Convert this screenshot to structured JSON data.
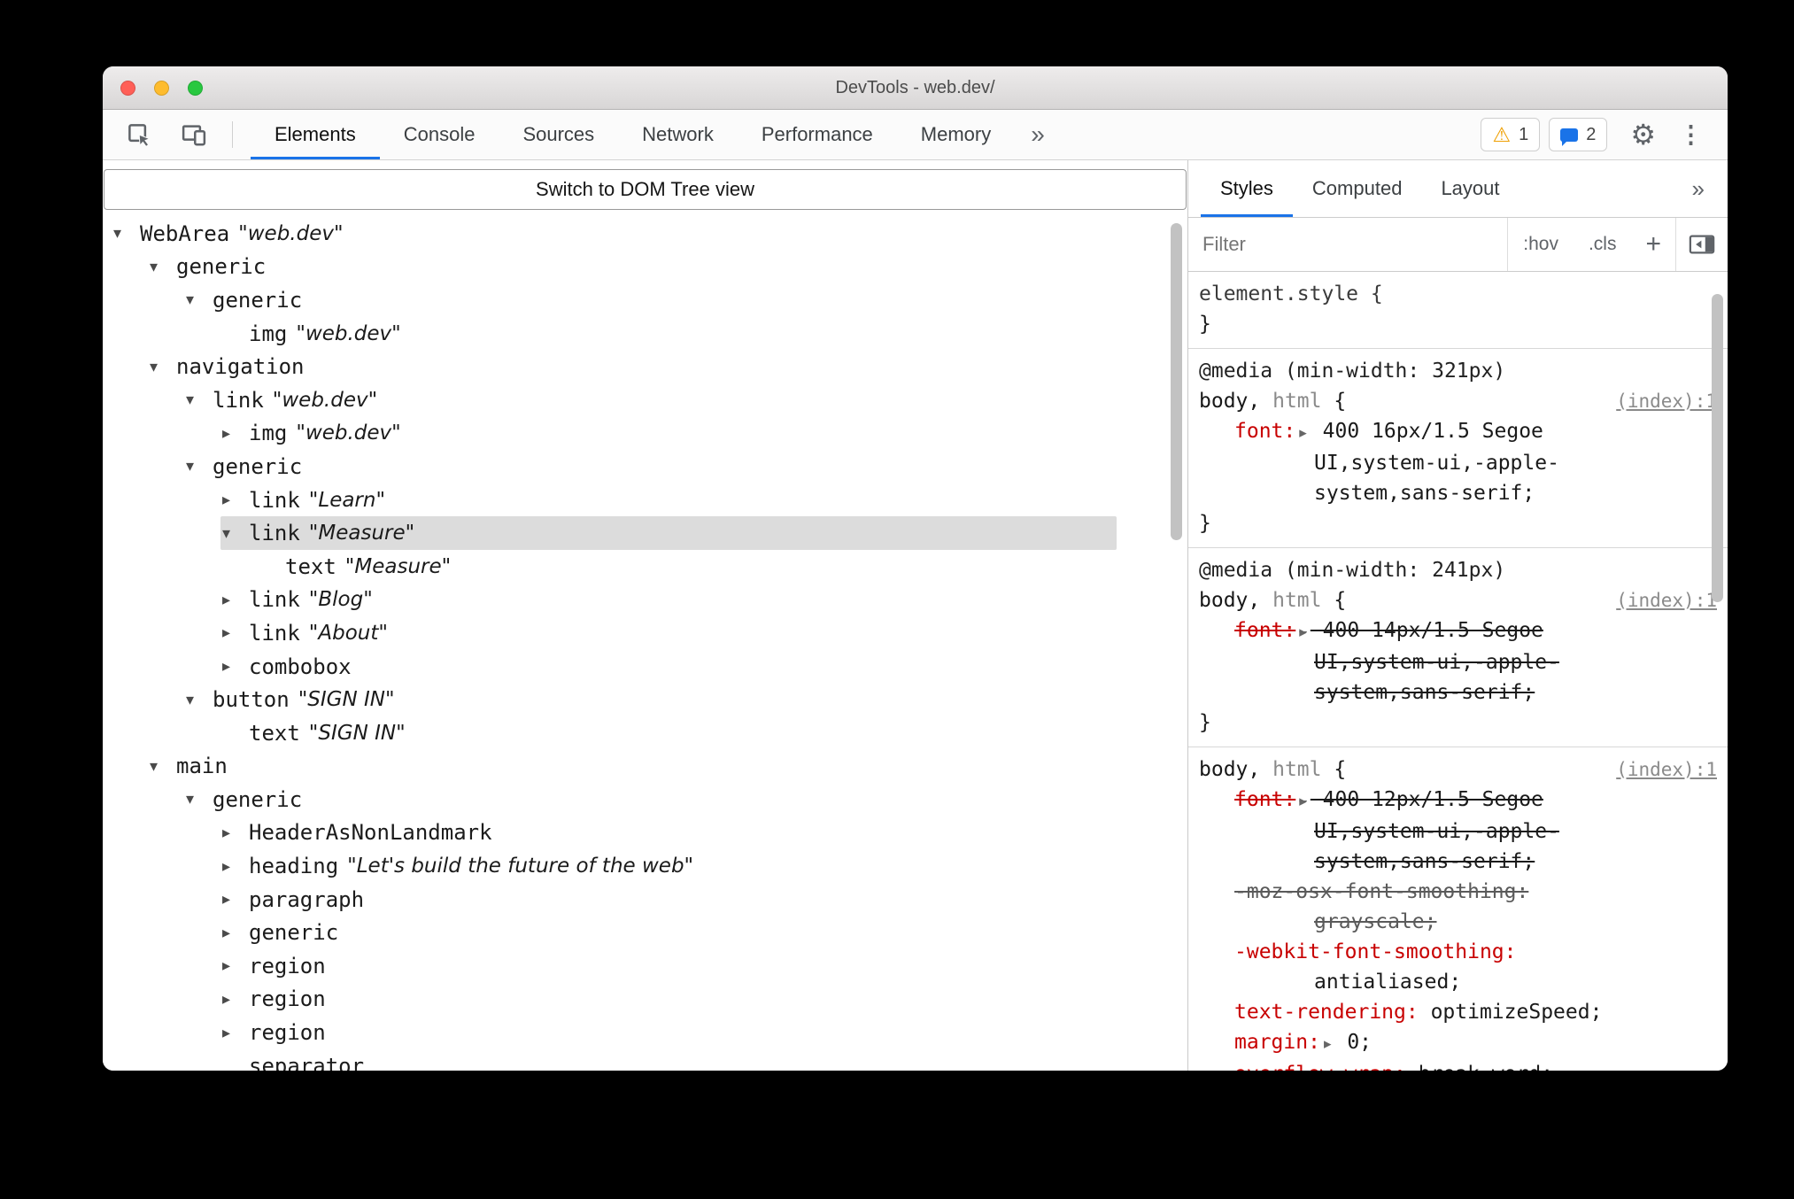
{
  "window": {
    "title": "DevTools - web.dev/"
  },
  "toolbar": {
    "tabs": [
      {
        "label": "Elements",
        "active": true
      },
      {
        "label": "Console",
        "active": false
      },
      {
        "label": "Sources",
        "active": false
      },
      {
        "label": "Network",
        "active": false
      },
      {
        "label": "Performance",
        "active": false
      },
      {
        "label": "Memory",
        "active": false
      }
    ],
    "warning_count": "1",
    "message_count": "2"
  },
  "left_pane": {
    "dom_tree_toggle_label": "Switch to DOM Tree view",
    "tree": [
      {
        "level": 0,
        "arrow": "down",
        "role": "WebArea",
        "name": "web.dev"
      },
      {
        "level": 1,
        "arrow": "down",
        "role": "generic"
      },
      {
        "level": 2,
        "arrow": "down",
        "role": "generic"
      },
      {
        "level": 3,
        "arrow": "none",
        "role": "img",
        "name": "web.dev"
      },
      {
        "level": 1,
        "arrow": "down",
        "role": "navigation"
      },
      {
        "level": 2,
        "arrow": "down",
        "role": "link",
        "name": "web.dev"
      },
      {
        "level": 3,
        "arrow": "right",
        "role": "img",
        "name": "web.dev"
      },
      {
        "level": 2,
        "arrow": "down",
        "role": "generic"
      },
      {
        "level": 3,
        "arrow": "right",
        "role": "link",
        "name": "Learn"
      },
      {
        "level": 3,
        "arrow": "down",
        "role": "link",
        "name": "Measure",
        "selected": true
      },
      {
        "level": 4,
        "arrow": "none",
        "role": "text",
        "name": "Measure"
      },
      {
        "level": 3,
        "arrow": "right",
        "role": "link",
        "name": "Blog"
      },
      {
        "level": 3,
        "arrow": "right",
        "role": "link",
        "name": "About"
      },
      {
        "level": 3,
        "arrow": "right",
        "role": "combobox"
      },
      {
        "level": 2,
        "arrow": "down",
        "role": "button",
        "name": "SIGN IN"
      },
      {
        "level": 3,
        "arrow": "none",
        "role": "text",
        "name": "SIGN IN"
      },
      {
        "level": 1,
        "arrow": "down",
        "role": "main"
      },
      {
        "level": 2,
        "arrow": "down",
        "role": "generic"
      },
      {
        "level": 3,
        "arrow": "right",
        "role": "HeaderAsNonLandmark"
      },
      {
        "level": 3,
        "arrow": "right",
        "role": "heading",
        "name": "Let's build the future of the web"
      },
      {
        "level": 3,
        "arrow": "right",
        "role": "paragraph"
      },
      {
        "level": 3,
        "arrow": "right",
        "role": "generic"
      },
      {
        "level": 3,
        "arrow": "right",
        "role": "region"
      },
      {
        "level": 3,
        "arrow": "right",
        "role": "region"
      },
      {
        "level": 3,
        "arrow": "right",
        "role": "region"
      },
      {
        "level": 3,
        "arrow": "none",
        "role": "separator"
      }
    ]
  },
  "styles_pane": {
    "tabs": [
      {
        "label": "Styles",
        "active": true
      },
      {
        "label": "Computed",
        "active": false
      },
      {
        "label": "Layout",
        "active": false
      }
    ],
    "filter_placeholder": "Filter",
    "pseudo_toggle_label": ":hov",
    "class_toggle_label": ".cls",
    "sections": [
      {
        "selector_line": "element.style {",
        "close": "}",
        "declarations": []
      },
      {
        "media": "@media (min-width: 321px)",
        "selector": "body,",
        "selector_secondary": "html",
        "link": "(index):1",
        "close": "}",
        "declarations": [
          {
            "property": "font",
            "arrow": true,
            "struck": false,
            "gray": false,
            "value": "400 16px/1.5 Segoe UI,system-ui,-apple-system,sans-serif;"
          }
        ]
      },
      {
        "media": "@media (min-width: 241px)",
        "selector": "body,",
        "selector_secondary": "html",
        "link": "(index):1",
        "close": "}",
        "declarations": [
          {
            "property": "font",
            "arrow": true,
            "struck": true,
            "gray": false,
            "value": "400 14px/1.5 Segoe UI,system-ui,-apple-system,sans-serif;"
          }
        ]
      },
      {
        "selector": "body,",
        "selector_secondary": "html",
        "link": "(index):1",
        "close": "}",
        "declarations": [
          {
            "property": "font",
            "arrow": true,
            "struck": true,
            "gray": false,
            "value": "400 12px/1.5 Segoe UI,system-ui,-apple-system,sans-serif;"
          },
          {
            "property": "-moz-osx-font-smoothing",
            "arrow": false,
            "struck": true,
            "gray": true,
            "value": "grayscale;"
          },
          {
            "property": "-webkit-font-smoothing",
            "arrow": false,
            "struck": false,
            "gray": false,
            "value": "antialiased;"
          },
          {
            "property": "text-rendering",
            "arrow": false,
            "struck": false,
            "gray": false,
            "value": "optimizeSpeed;"
          },
          {
            "property": "margin",
            "arrow": true,
            "struck": false,
            "gray": false,
            "value": "0;"
          },
          {
            "property": "overflow-wrap",
            "arrow": false,
            "struck": true,
            "gray": false,
            "value": "break-word;"
          }
        ]
      }
    ]
  },
  "glyphs": {
    "expanded": "▾",
    "collapsed": "▸",
    "more_tabs": "»",
    "overflow_menu": "⋮",
    "gear": "⚙",
    "add_rule": "+",
    "warning": "⚠"
  },
  "colors": {
    "accent": "#1a73e8",
    "css_property": "#c80000",
    "selection": "#dcdcdc",
    "warning": "#f0a000"
  }
}
